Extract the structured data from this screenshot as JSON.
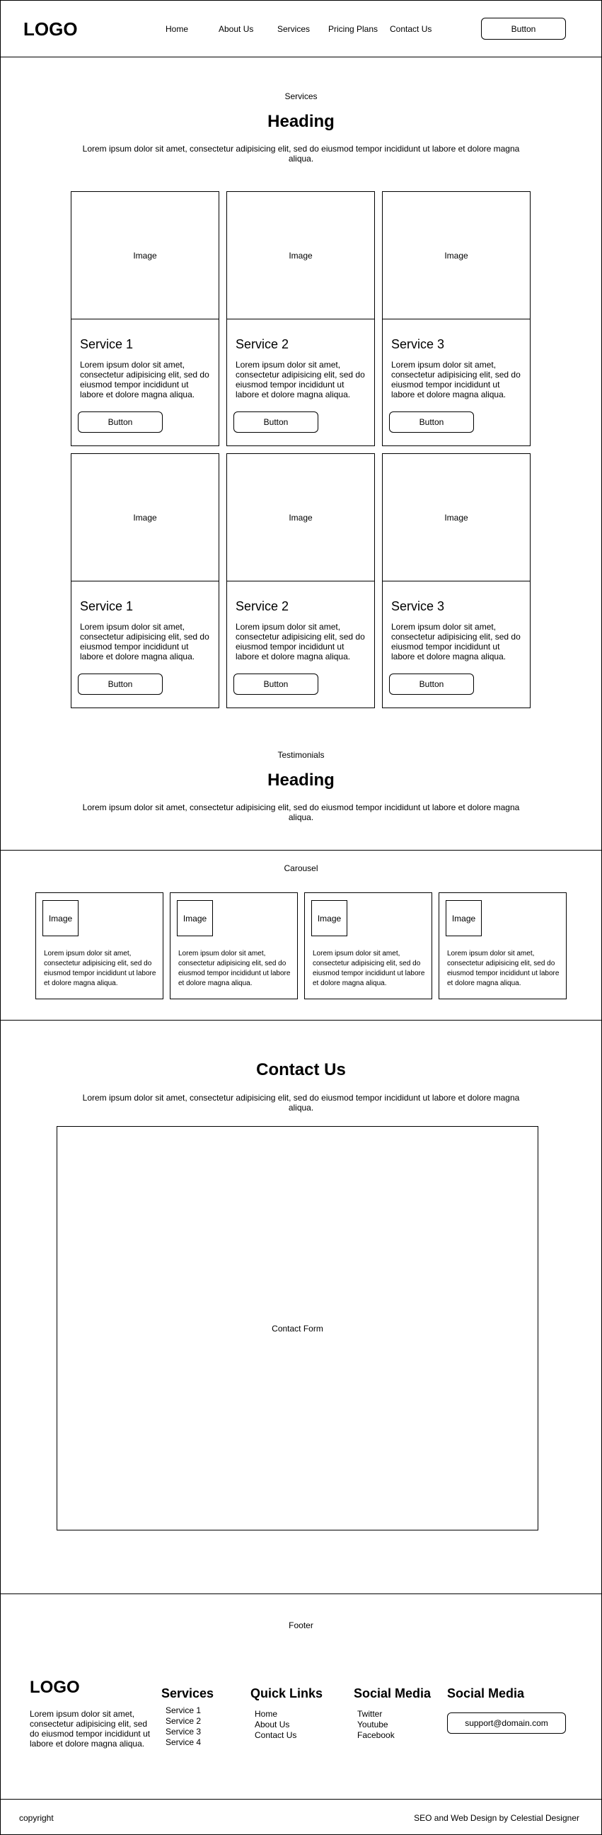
{
  "header": {
    "logo": "LOGO",
    "nav": [
      "Home",
      "About Us",
      "Services",
      "Pricing Plans",
      "Contact Us"
    ],
    "button_label": "Button"
  },
  "services": {
    "section_label": "Services",
    "heading": "Heading",
    "intro": "Lorem ipsum dolor sit amet, consectetur adipisicing elit, sed do eiusmod tempor incididunt ut labore et dolore magna aliqua.",
    "cards": [
      {
        "image": "Image",
        "title": "Service 1",
        "text": "Lorem ipsum dolor sit amet, consectetur adipisicing elit, sed do eiusmod tempor incididunt ut labore et dolore magna aliqua.",
        "button": "Button"
      },
      {
        "image": "Image",
        "title": "Service 2",
        "text": "Lorem ipsum dolor sit amet, consectetur adipisicing elit, sed do eiusmod tempor incididunt ut labore et dolore magna aliqua.",
        "button": "Button"
      },
      {
        "image": "Image",
        "title": "Service 3",
        "text": "Lorem ipsum dolor sit amet, consectetur adipisicing elit, sed do eiusmod tempor incididunt ut labore et dolore magna aliqua.",
        "button": "Button"
      },
      {
        "image": "Image",
        "title": "Service 1",
        "text": "Lorem ipsum dolor sit amet, consectetur adipisicing elit, sed do eiusmod tempor incididunt ut labore et dolore magna aliqua.",
        "button": "Button"
      },
      {
        "image": "Image",
        "title": "Service 2",
        "text": "Lorem ipsum dolor sit amet, consectetur adipisicing elit, sed do eiusmod tempor incididunt ut labore et dolore magna aliqua.",
        "button": "Button"
      },
      {
        "image": "Image",
        "title": "Service 3",
        "text": "Lorem ipsum dolor sit amet, consectetur adipisicing elit, sed do eiusmod tempor incididunt ut labore et dolore magna aliqua.",
        "button": "Button"
      }
    ]
  },
  "testimonials": {
    "section_label": "Testimonials",
    "heading": "Heading",
    "intro": "Lorem ipsum dolor sit amet, consectetur adipisicing elit, sed do eiusmod tempor incididunt ut labore et dolore magna aliqua."
  },
  "carousel": {
    "label": "Carousel",
    "items": [
      {
        "image": "Image",
        "text": "Lorem ipsum dolor sit amet, consectetur adipisicing elit, sed do eiusmod tempor incididunt ut labore et dolore magna aliqua."
      },
      {
        "image": "Image",
        "text": "Lorem ipsum dolor sit amet, consectetur adipisicing elit, sed do eiusmod tempor incididunt ut labore et dolore magna aliqua."
      },
      {
        "image": "Image",
        "text": "Lorem ipsum dolor sit amet, consectetur adipisicing elit, sed do eiusmod tempor incididunt ut labore et dolore magna aliqua."
      },
      {
        "image": "Image",
        "text": "Lorem ipsum dolor sit amet, consectetur adipisicing elit, sed do eiusmod tempor incididunt ut labore et dolore magna aliqua."
      }
    ]
  },
  "contact": {
    "heading": "Contact Us",
    "intro": "Lorem ipsum dolor sit amet, consectetur adipisicing elit, sed do eiusmod tempor incididunt ut labore et dolore magna aliqua.",
    "form_label": "Contact Form"
  },
  "footer": {
    "label": "Footer",
    "logo": "LOGO",
    "about": "Lorem ipsum dolor sit amet, consectetur adipisicing elit, sed do eiusmod tempor incididunt ut labore et dolore magna aliqua.",
    "services_title": "Services",
    "services": [
      "Service 1",
      "Service 2",
      "Service 3",
      "Service 4"
    ],
    "quick_links_title": "Quick Links",
    "quick_links": [
      "Home",
      "About Us",
      "Contact Us"
    ],
    "social_title": "Social Media",
    "social": [
      "Twitter",
      "Youtube",
      "Facebook"
    ],
    "social_title_2": "Social Media",
    "email_button": "support@domain.com",
    "copyright": "copyright",
    "credit": "SEO and Web Design by Celestial Designer"
  }
}
